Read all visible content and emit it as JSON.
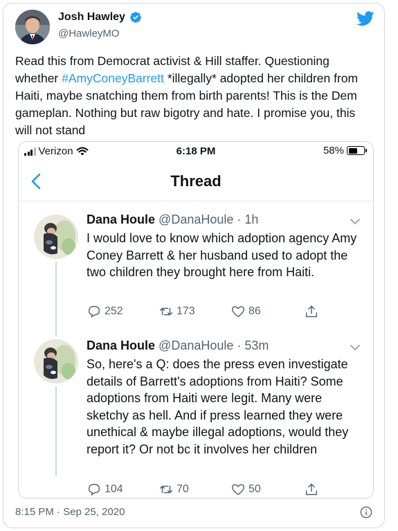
{
  "author": {
    "name": "Josh Hawley",
    "handle": "@HawleyMO",
    "verified": true
  },
  "tweet": {
    "text_before": "Read this from Democrat activist & Hill staffer. Questioning whether ",
    "hashtag": "#AmyConeyBarrett",
    "text_after": " *illegally* adopted her children from Haiti, maybe snatching them from birth parents! This is the Dem gameplan. Nothing but raw bigotry and hate. I promise you, this will not stand",
    "timestamp": "8:15 PM · Sep 25, 2020"
  },
  "screenshot": {
    "status_bar": {
      "carrier": "Verizon",
      "time": "6:18 PM",
      "battery": "58%",
      "battery_level": 0.58
    },
    "nav": {
      "title": "Thread"
    },
    "tweets": [
      {
        "name": "Dana Houle",
        "handle": "@DanaHoule",
        "time": "· 1h",
        "text": "I would love to know which adoption agency Amy Coney Barrett & her husband used to adopt the two children they brought here from Haiti.",
        "replies": "252",
        "retweets": "173",
        "likes": "86"
      },
      {
        "name": "Dana Houle",
        "handle": "@DanaHoule",
        "time": "· 53m",
        "text": "So, here's a Q: does the press even investigate details of Barrett's adoptions from Haiti? Some adoptions from Haiti were legit. Many were sketchy as hell. And if press learned they were unethical & maybe illegal adoptions, would they report it? Or not bc it involves her children",
        "replies": "104",
        "retweets": "70",
        "likes": "50"
      }
    ]
  },
  "colors": {
    "link": "#1d9bf0",
    "text": "#0f1419",
    "secondary": "#536471",
    "border": "#cfd9de"
  }
}
